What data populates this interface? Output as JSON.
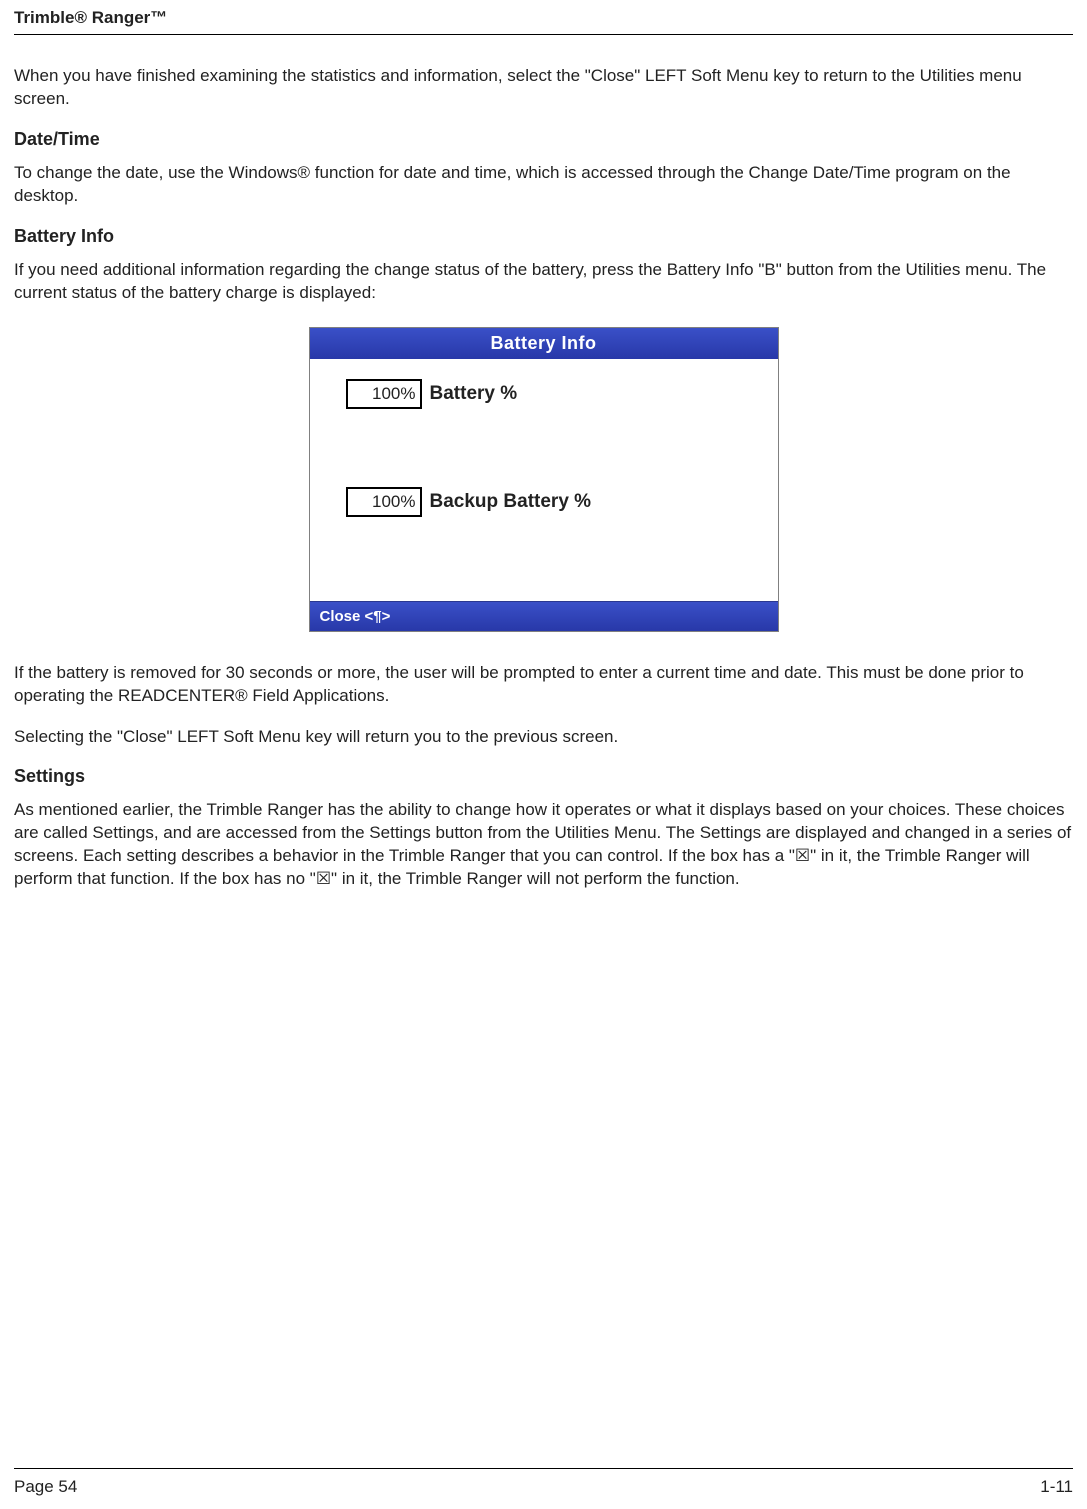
{
  "header": {
    "title": "Trimble® Ranger™"
  },
  "paragraphs": {
    "intro": "When you have finished examining the statistics and information, select the \"Close\" LEFT Soft Menu key to return to the Utilities menu screen.",
    "datetime_heading": "Date/Time",
    "datetime_body": "To change the date, use the Windows® function for date and time, which is accessed through the Change Date/Time program on the desktop.",
    "battery_heading": "Battery Info",
    "battery_body1": "If you need additional information regarding the change status of the battery, press the Battery Info \"B\" button from the Utilities menu.  The current status of the battery charge is displayed:",
    "battery_body2": "If the battery is removed for 30 seconds or more, the user will be prompted to enter a current time and date. This must be done prior to operating the READCENTER® Field Applications.",
    "battery_body3": "Selecting the \"Close\" LEFT Soft Menu key will return you to the previous screen.",
    "settings_heading": "Settings",
    "settings_body": "As mentioned earlier, the Trimble Ranger has the ability to change how it operates or what it displays based on your choices.  These choices are called Settings, and are accessed from the Settings button from the Utilities Menu.  The Settings are displayed and changed in a series of screens.  Each setting describes a behavior in the Trimble Ranger that you can control.  If the box has a \"☒\" in it, the Trimble Ranger will perform that function.  If the box has no \"☒\" in it, the Trimble Ranger will not perform the function."
  },
  "battery_screen": {
    "title": "Battery Info",
    "battery_pct_value": "100%",
    "battery_pct_label": "Battery %",
    "backup_pct_value": "100%",
    "backup_pct_label": "Backup Battery %",
    "softkey_close": "Close <¶>"
  },
  "footer": {
    "left": "Page 54",
    "right": "1-11"
  }
}
